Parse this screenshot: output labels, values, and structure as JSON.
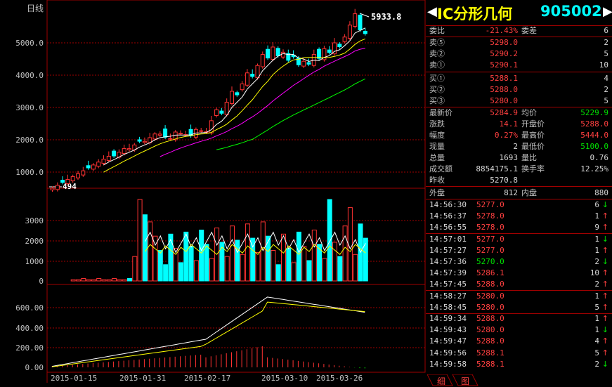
{
  "chart": {
    "period_label": "日线",
    "peak_label": "5933.8",
    "low_label": "494",
    "price_ticks": [
      "5000.0",
      "4000.0",
      "3000.0",
      "2000.0",
      "1000.0"
    ],
    "volume_ticks": [
      "3000",
      "2000",
      "1000",
      "0"
    ],
    "indicator_ticks": [
      "600.00",
      "400.00",
      "200.00",
      "0.00"
    ],
    "dates": [
      "2015-01-15",
      "2015-01-31",
      "2015-02-17",
      "2015-03-10",
      "2015-03-26"
    ],
    "colors": {
      "up": "#ff3232",
      "down": "#00ffff",
      "ma5": "#ffffff",
      "ma10": "#ffff00",
      "ma20": "#ff00ff",
      "ma60": "#00ff00",
      "grid": "#a00000"
    }
  },
  "quote": {
    "title": "IC分形几何",
    "code": "905002",
    "webi_label": "委比",
    "webi_value": "-21.43%",
    "wecha_label": "委差",
    "wecha_value": "6",
    "asks": [
      {
        "label": "卖⑤",
        "price": "5298.0",
        "vol": "2"
      },
      {
        "label": "卖②",
        "price": "5290.2",
        "vol": "5"
      },
      {
        "label": "卖①",
        "price": "5290.1",
        "vol": "10"
      }
    ],
    "bids": [
      {
        "label": "买①",
        "price": "5288.1",
        "vol": "4"
      },
      {
        "label": "买②",
        "price": "5288.0",
        "vol": "2"
      },
      {
        "label": "买③",
        "price": "5280.0",
        "vol": "5"
      }
    ],
    "stats": [
      {
        "l1": "最新价",
        "v1": "5284.9",
        "l2": "均价",
        "v2": "5229.9"
      },
      {
        "l1": "涨跌",
        "v1": "14.1",
        "l2": "开盘价",
        "v2": "5288.0"
      },
      {
        "l1": "幅度",
        "v1": "0.27%",
        "l2": "最高价",
        "v2": "5444.0"
      },
      {
        "l1": "现量",
        "v1": "2",
        "l2": "最低价",
        "v2": "5100.0"
      },
      {
        "l1": "总量",
        "v1": "1693",
        "l2": "量比",
        "v2": "0.76"
      },
      {
        "l1": "成交额",
        "v1": "8854175.1",
        "l2": "换手率",
        "v2": "12.25%"
      }
    ],
    "prev_close_label": "昨收",
    "prev_close_value": "5270.8",
    "outer_label": "外盘",
    "outer_value": "812",
    "inner_label": "内盘",
    "inner_value": "880",
    "ticks": [
      {
        "time": "14:56:30",
        "price": "5277.0",
        "vol": "6",
        "dir": "down"
      },
      {
        "time": "14:56:37",
        "price": "5278.0",
        "vol": "1",
        "dir": "up"
      },
      {
        "time": "14:56:55",
        "price": "5278.0",
        "vol": "9",
        "dir": "up"
      },
      {
        "time": "14:57:01",
        "price": "5277.0",
        "vol": "1",
        "dir": "down"
      },
      {
        "time": "14:57:27",
        "price": "5277.0",
        "vol": "1",
        "dir": "up"
      },
      {
        "time": "14:57:36",
        "price": "5270.0",
        "vol": "2",
        "dir": "down"
      },
      {
        "time": "14:57:39",
        "price": "5286.1",
        "vol": "10",
        "dir": "up"
      },
      {
        "time": "14:57:45",
        "price": "5288.0",
        "vol": "2",
        "dir": "up"
      },
      {
        "time": "14:58:27",
        "price": "5280.0",
        "vol": "1",
        "dir": "up"
      },
      {
        "time": "14:58:45",
        "price": "5280.0",
        "vol": "5",
        "dir": "up"
      },
      {
        "time": "14:59:34",
        "price": "5288.0",
        "vol": "1",
        "dir": "up"
      },
      {
        "time": "14:59:43",
        "price": "5280.0",
        "vol": "1",
        "dir": "down"
      },
      {
        "time": "14:59:47",
        "price": "5288.0",
        "vol": "4",
        "dir": "up"
      },
      {
        "time": "14:59:56",
        "price": "5288.1",
        "vol": "5",
        "dir": "up"
      },
      {
        "time": "14:59:58",
        "price": "5288.1",
        "vol": "2",
        "dir": "down"
      }
    ],
    "tab1": "细",
    "tab2": "图"
  }
}
